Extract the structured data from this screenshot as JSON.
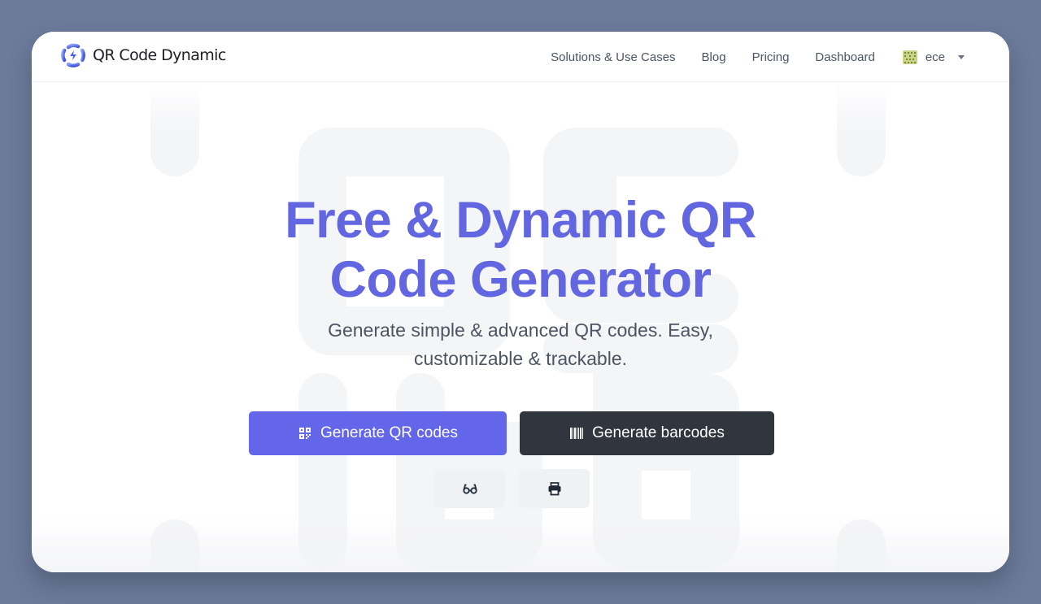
{
  "brand": {
    "name": "QR Code Dynamic",
    "logo_icon": "rotating-arrows-bolt-icon",
    "accent_color": "#6366e8"
  },
  "nav": {
    "links": [
      {
        "label": "Solutions & Use Cases"
      },
      {
        "label": "Blog"
      },
      {
        "label": "Pricing"
      },
      {
        "label": "Dashboard"
      }
    ],
    "user": {
      "name": "ece",
      "avatar_icon": "pixel-avatar-icon",
      "dropdown_icon": "caret-down-icon"
    }
  },
  "hero": {
    "title_line1": "Free & Dynamic QR",
    "title_line2": "Code Generator",
    "subtitle_line1": "Generate simple & advanced QR codes. Easy,",
    "subtitle_line2": "customizable & trackable.",
    "primary_button": {
      "label": "Generate QR codes",
      "icon": "qr-code-icon",
      "color": "#6366e8"
    },
    "secondary_button": {
      "label": "Generate barcodes",
      "icon": "barcode-icon",
      "color": "#31353d"
    },
    "icon_buttons": [
      {
        "icon": "glasses-icon"
      },
      {
        "icon": "printer-icon"
      }
    ]
  }
}
